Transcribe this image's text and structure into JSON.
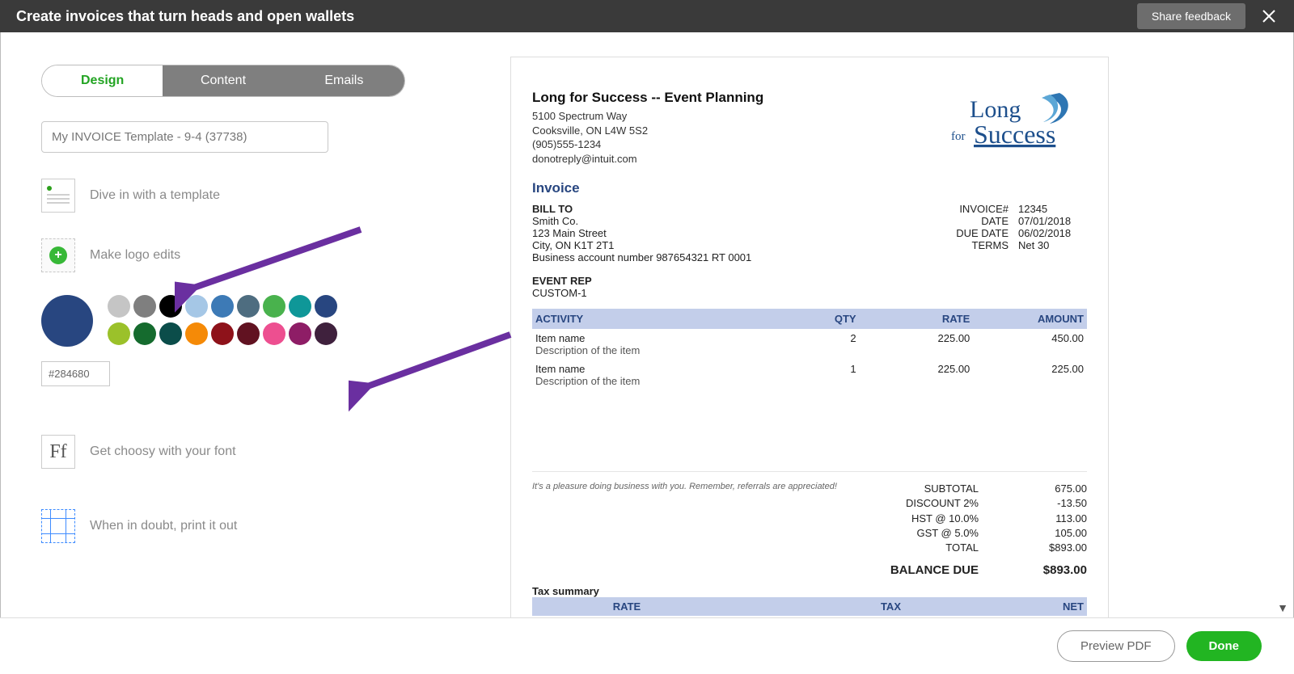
{
  "header": {
    "title": "Create invoices that turn heads and open wallets",
    "share_feedback": "Share feedback"
  },
  "tabs": {
    "design": "Design",
    "content": "Content",
    "emails": "Emails"
  },
  "template_name": "My INVOICE Template - 9-4 (37738)",
  "design_options": {
    "template_label": "Dive in with a template",
    "logo_label": "Make logo edits",
    "font_label": "Get choosy with your font",
    "print_label": "When in doubt, print it out"
  },
  "palette_row1": [
    "#c5c5c5",
    "#7f7f7f",
    "#000000",
    "#a5c7e6",
    "#3d7ab6",
    "#4e6d80",
    "#49b24d",
    "#0f9798",
    "#284680"
  ],
  "palette_row2": [
    "#9bc12a",
    "#156b2e",
    "#0b4d4a",
    "#f58a07",
    "#8e121a",
    "#611221",
    "#ed4f90",
    "#8e1d66",
    "#3f213d"
  ],
  "selected_color_hex": "#284680",
  "invoice": {
    "company_name": "Long for Success -- Event Planning",
    "addr1": "5100 Spectrum Way",
    "addr2": "Cooksville, ON L4W 5S2",
    "phone": "(905)555-1234",
    "email": "donotreply@intuit.com",
    "logo_text_top": "Long",
    "logo_text_for": "for",
    "logo_text_bottom": "Success",
    "invoice_title": "Invoice",
    "billto_heading": "BILL TO",
    "billto_lines": [
      "Smith Co.",
      "123 Main Street",
      "City, ON K1T 2T1",
      "Business account number  987654321 RT 0001"
    ],
    "meta": {
      "invoice_num_label": "INVOICE#",
      "invoice_num": "12345",
      "date_label": "DATE",
      "date": "07/01/2018",
      "due_label": "DUE DATE",
      "due": "06/02/2018",
      "terms_label": "TERMS",
      "terms": "Net 30"
    },
    "eventrep_h": "EVENT REP",
    "eventrep_v": "CUSTOM-1",
    "cols": {
      "activity": "ACTIVITY",
      "qty": "QTY",
      "rate": "RATE",
      "amount": "AMOUNT"
    },
    "items": [
      {
        "name": "Item name",
        "desc": "Description of the item",
        "qty": "2",
        "rate": "225.00",
        "amount": "450.00"
      },
      {
        "name": "Item name",
        "desc": "Description of the item",
        "qty": "1",
        "rate": "225.00",
        "amount": "225.00"
      }
    ],
    "footer_msg": "It's a pleasure doing business with you. Remember, referrals are appreciated!",
    "summary": {
      "subtotal_l": "SUBTOTAL",
      "subtotal_v": "675.00",
      "discount_l": "DISCOUNT 2%",
      "discount_v": "-13.50",
      "hst_l": "HST @ 10.0%",
      "hst_v": "113.00",
      "gst_l": "GST @ 5.0%",
      "gst_v": "105.00",
      "total_l": "TOTAL",
      "total_v": "$893.00",
      "balance_l": "BALANCE DUE",
      "balance_v": "$893.00"
    },
    "tax_summary_h": "Tax summary",
    "tax_cols": {
      "rate": "RATE",
      "tax": "TAX",
      "net": "NET"
    }
  },
  "footer": {
    "preview": "Preview PDF",
    "done": "Done"
  }
}
